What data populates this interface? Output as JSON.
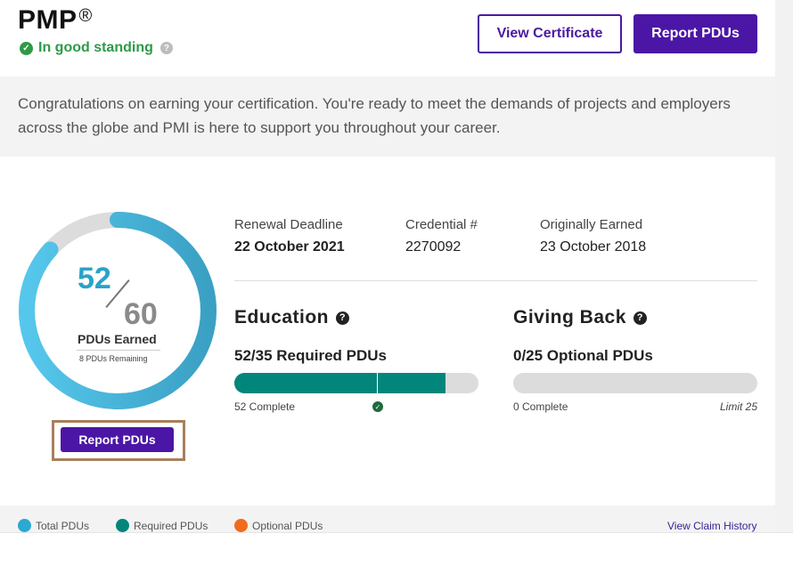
{
  "header": {
    "title": "PMP",
    "title_mark": "®",
    "standing": "In good standing",
    "view_certificate_label": "View Certificate",
    "report_pdus_label": "Report PDUs"
  },
  "banner": {
    "text": "Congratulations on earning your certification. You're ready to meet the demands of projects and employers across the globe and PMI is here to support you throughout your career."
  },
  "progress": {
    "earned": "52",
    "total": "60",
    "earned_label": "PDUs Earned",
    "remaining_label": "8 PDUs Remaining",
    "fraction": 0.867,
    "report_button": "Report PDUs"
  },
  "details": {
    "renewal_label": "Renewal Deadline",
    "renewal_value": "22 October 2021",
    "credential_label": "Credential #",
    "credential_value": "2270092",
    "earned_label": "Originally Earned",
    "earned_value": "23 October 2018"
  },
  "education": {
    "title": "Education",
    "subtitle": "52/35 Required PDUs",
    "caption": "52 Complete",
    "completed": 52,
    "required": 35,
    "bar_max": 60
  },
  "giving_back": {
    "title": "Giving Back",
    "subtitle": "0/25 Optional PDUs",
    "caption": "0 Complete",
    "limit": "Limit 25",
    "completed": 0,
    "max": 25
  },
  "legend": {
    "total": "Total PDUs",
    "required": "Required PDUs",
    "optional": "Optional PDUs",
    "history_link": "View Claim History"
  },
  "colors": {
    "brand_purple": "#4b16a6",
    "success_green": "#2e9a47",
    "donut_blue": "#4fc0e6",
    "teal": "#02867b",
    "orange": "#f26b1d"
  }
}
